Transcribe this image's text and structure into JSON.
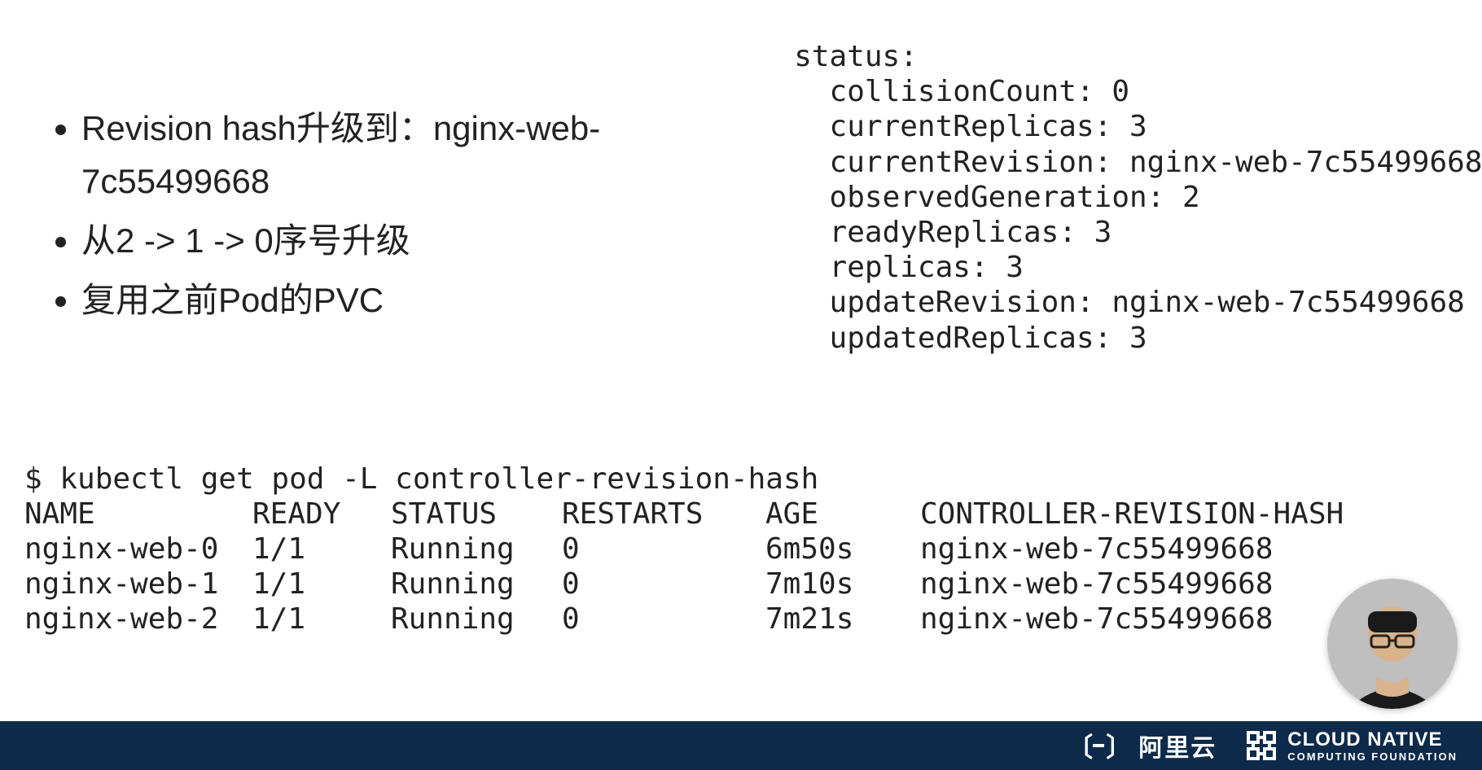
{
  "bullets": [
    "Revision hash升级到：nginx-web-7c55499668",
    "从2 -> 1 -> 0序号升级",
    "复用之前Pod的PVC"
  ],
  "status": {
    "header": "status:",
    "fields": {
      "collisionCount": "collisionCount: 0",
      "currentReplicas": "currentReplicas: 3",
      "currentRevision": "currentRevision: nginx-web-7c55499668",
      "observedGeneration": "observedGeneration: 2",
      "readyReplicas": "readyReplicas: 3",
      "replicas": "replicas: 3",
      "updateRevision": "updateRevision: nginx-web-7c55499668",
      "updatedReplicas": "updatedReplicas: 3"
    }
  },
  "command": "$ kubectl get pod -L controller-revision-hash",
  "table": {
    "headers": [
      "NAME",
      "READY",
      "STATUS",
      "RESTARTS",
      "AGE",
      "CONTROLLER-REVISION-HASH"
    ],
    "rows": [
      [
        "nginx-web-0",
        "1/1",
        "Running",
        "0",
        "6m50s",
        "nginx-web-7c55499668"
      ],
      [
        "nginx-web-1",
        "1/1",
        "Running",
        "0",
        "7m10s",
        "nginx-web-7c55499668"
      ],
      [
        "nginx-web-2",
        "1/1",
        "Running",
        "0",
        "7m21s",
        "nginx-web-7c55499668"
      ]
    ]
  },
  "footer": {
    "aliyun": "阿里云",
    "cncf_line1": "CLOUD NATIVE",
    "cncf_line2": "COMPUTING FOUNDATION"
  }
}
